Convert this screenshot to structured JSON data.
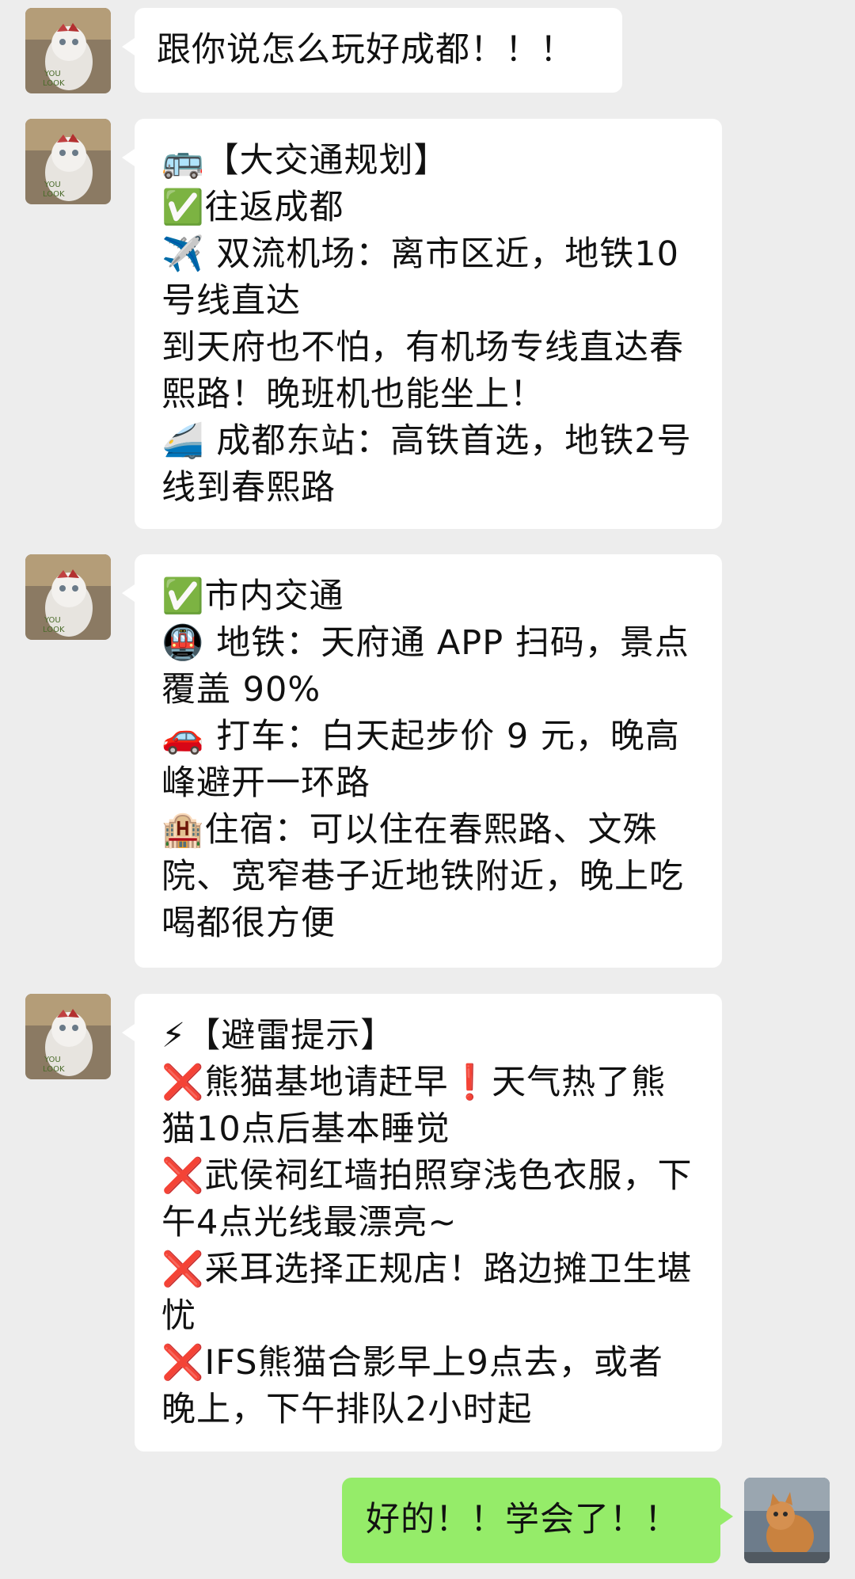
{
  "messages": [
    {
      "sender": "other",
      "text": "跟你说怎么玩好成都！！！"
    },
    {
      "sender": "other",
      "lines": [
        "🚌【大交通规划】",
        "✅往返成都",
        "✈️ 双流机场：离市区近，地铁10号线直达",
        "到天府也不怕，有机场专线直达春熙路！晚班机也能坐上！",
        "🚄 成都东站：高铁首选，地铁2号线到春熙路"
      ]
    },
    {
      "sender": "other",
      "lines": [
        "✅市内交通",
        "🚇 地铁：天府通 APP 扫码，景点覆盖 90%",
        "🚗 打车：白天起步价 9 元，晚高峰避开一环路",
        "🏨住宿：可以住在春熙路、文殊院、宽窄巷子近地铁附近，晚上吃喝都很方便"
      ]
    },
    {
      "sender": "other",
      "lines": [
        "⚡【避雷提示】",
        "❌熊猫基地请赶早❗天气热了熊猫10点后基本睡觉",
        "❌武侯祠红墙拍照穿浅色衣服，下午4点光线最漂亮~",
        "❌采耳选择正规店！路边摊卫生堪忧",
        "❌IFS熊猫合影早上9点去，或者晚上，下午排队2小时起"
      ]
    },
    {
      "sender": "me",
      "text": "好的！！学会了！！"
    }
  ],
  "colors": {
    "background": "#ededed",
    "other_bubble": "#ffffff",
    "my_bubble": "#95ec69"
  },
  "icons": {
    "other_avatar": "white-cat-avatar-icon",
    "my_avatar": "orange-cat-avatar-icon"
  }
}
